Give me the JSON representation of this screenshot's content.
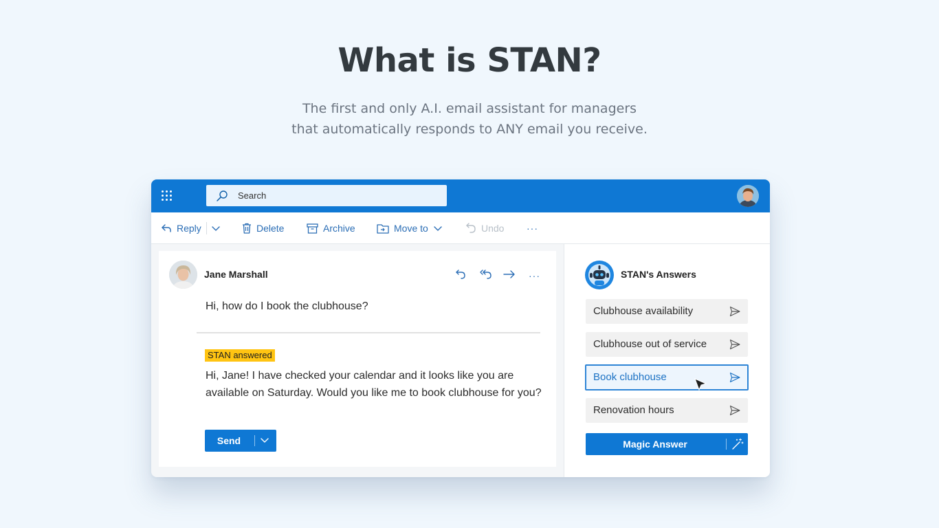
{
  "hero": {
    "title": "What is STAN?",
    "subtitle_line1": "The first and only A.I. email assistant for managers",
    "subtitle_line2": "that automatically responds to ANY email you receive."
  },
  "topbar": {
    "search_label": "Search",
    "color": "#0f78d4"
  },
  "toolbar": {
    "reply": "Reply",
    "delete": "Delete",
    "archive": "Archive",
    "move_to": "Move to",
    "undo": "Undo",
    "more": "···"
  },
  "mail": {
    "sender_name": "Jane Marshall",
    "question": "Hi, how do I book the clubhouse?",
    "badge": "STAN answered",
    "answer_line1": "Hi, Jane! I have checked your calendar and it looks like you are",
    "answer_line2": "available on Saturday. Would you like me to book clubhouse for you?",
    "send_label": "Send"
  },
  "side": {
    "title": "STAN's Answers",
    "answers": [
      {
        "label": "Clubhouse availability"
      },
      {
        "label": "Clubhouse out of service"
      },
      {
        "label": "Book clubhouse"
      },
      {
        "label": "Renovation hours"
      }
    ],
    "active_index": 2,
    "magic_label": "Magic Answer"
  },
  "icons": {
    "apps": "apps-grid-icon",
    "search": "search-icon",
    "reply": "reply-icon",
    "delete": "trash-icon",
    "archive": "archive-icon",
    "move": "folder-move-icon",
    "undo": "undo-icon",
    "send": "paper-plane-icon",
    "wand": "magic-wand-icon"
  },
  "colors": {
    "brand_blue": "#0f78d4",
    "badge_yellow": "#ffc412",
    "active_border": "#2d84d6",
    "background": "#f0f7fd"
  }
}
